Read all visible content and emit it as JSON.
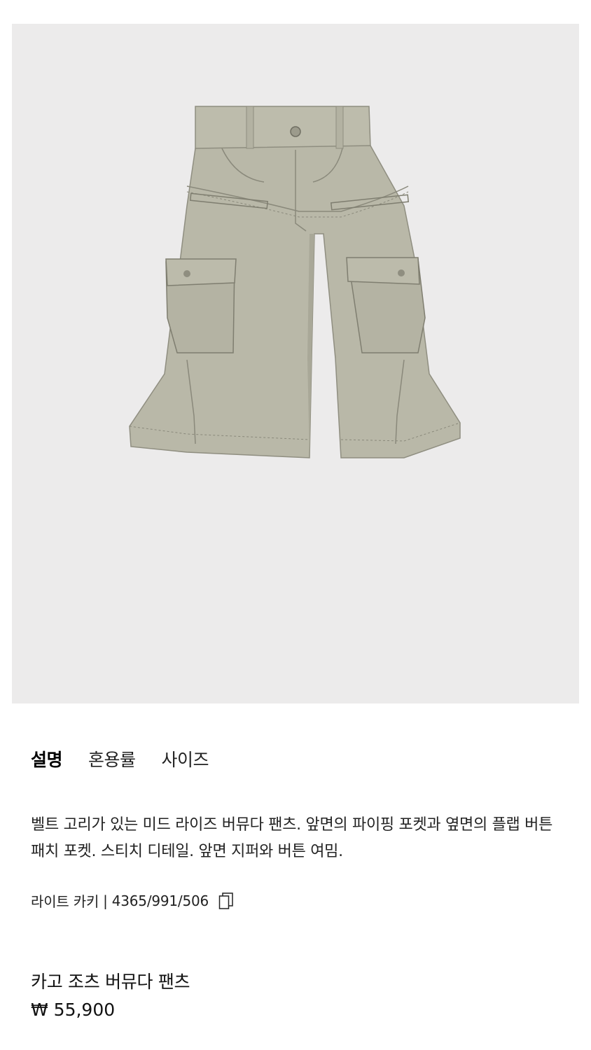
{
  "tabs": [
    {
      "label": "설명",
      "active": true
    },
    {
      "label": "혼용률",
      "active": false
    },
    {
      "label": "사이즈",
      "active": false
    }
  ],
  "description": "벨트 고리가 있는 미드 라이즈 버뮤다 팬츠. 앞면의 파이핑 포켓과 옆면의 플랩 버튼 패치 포켓. 스티치 디테일. 앞면 지퍼와 버튼 여밈.",
  "meta": {
    "color": "라이트 카키",
    "separator": "|",
    "reference": "4365/991/506",
    "copy_icon": "copy-icon"
  },
  "product": {
    "name": "카고 조츠 버뮤다 팬츠",
    "price": "₩ 55,900"
  },
  "image": {
    "background_color": "#ecebeb",
    "garment_color": "#b9b8a8"
  }
}
